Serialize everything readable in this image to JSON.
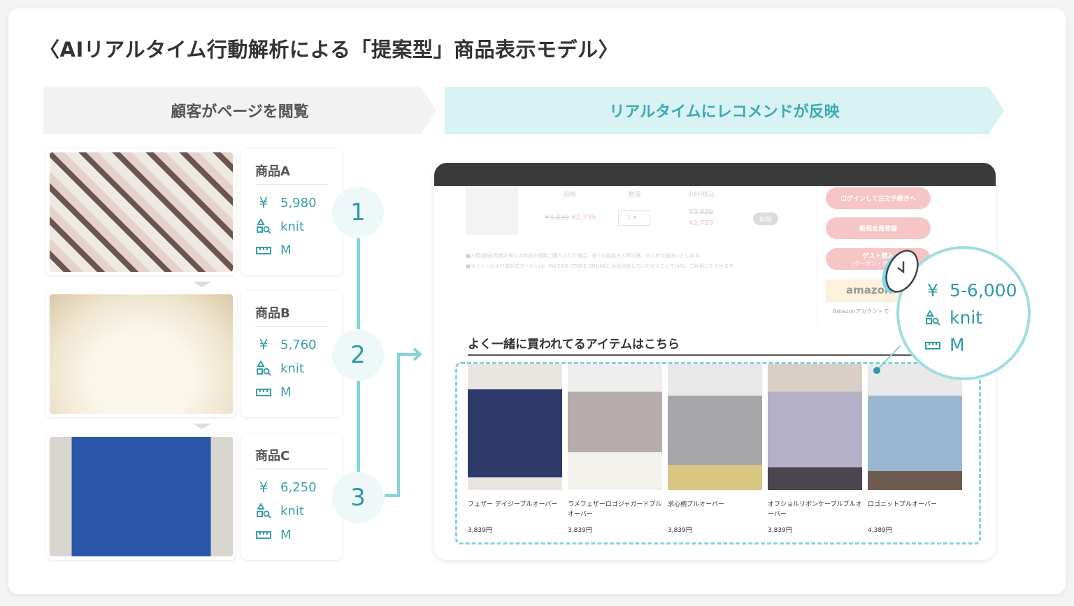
{
  "title": "〈AIリアルタイム行動解析による「提案型」商品表示モデル〉",
  "banners": {
    "left": "顧客がページを閲覧",
    "right": "リアルタイムにレコメンドが反映"
  },
  "products": [
    {
      "name": "商品A",
      "price": "5,980",
      "material": "knit",
      "size": "M",
      "step": "1"
    },
    {
      "name": "商品B",
      "price": "5,760",
      "material": "knit",
      "size": "M",
      "step": "2"
    },
    {
      "name": "商品C",
      "price": "6,250",
      "material": "knit",
      "size": "M",
      "step": "3"
    }
  ],
  "icons": {
    "price": "yen-icon",
    "material": "shapes-search-icon",
    "size": "ruler-icon",
    "time": "clock-icon"
  },
  "cart": {
    "headers": [
      "価格",
      "数量",
      "小計/税込"
    ],
    "old_price": "¥3,839",
    "new_price": "¥2,739",
    "qty": "1",
    "subtotal_old": "¥3,839",
    "subtotal_new": "¥2,739",
    "delete": "削除",
    "notes": [
      "■入荷(配送)時期が異なる商品を複数ご購入された場合、全ての商品を入荷次第、まとめて配送いたします。",
      "■ポイントおよび選択式クーポンは、PALEMO STORE ONLINEに会員登録していただくことで付与、ご利用いただけます。"
    ],
    "buttons": [
      "ログインして注文手続きへ",
      "新規会員登録",
      "ゲスト購入",
      "(クーポン・ポイント"
    ],
    "amazon": "amazon",
    "amazon_note": "Amazonアカウントで"
  },
  "recommend": {
    "heading": "よく一緒に買われてるアイテムはこちら",
    "items": [
      {
        "name": "フェザー デイジープルオーバー",
        "price": "3,839円"
      },
      {
        "name": "ラメフェザーロゴジャガードプルオーバー",
        "price": "3,839円"
      },
      {
        "name": "求心柄プルオーバー",
        "price": "3,839円"
      },
      {
        "name": "オフショルリボンケーブルプルオーバー",
        "price": "3,839円"
      },
      {
        "name": "ロゴニットプルオーバー",
        "price": "4,389円"
      }
    ]
  },
  "analysis": {
    "price": "5-6,000",
    "material": "knit",
    "size": "M"
  },
  "colors": {
    "accent": "#3aaab4",
    "line": "#86d3d8",
    "banner_right": "#d9f2f4"
  }
}
